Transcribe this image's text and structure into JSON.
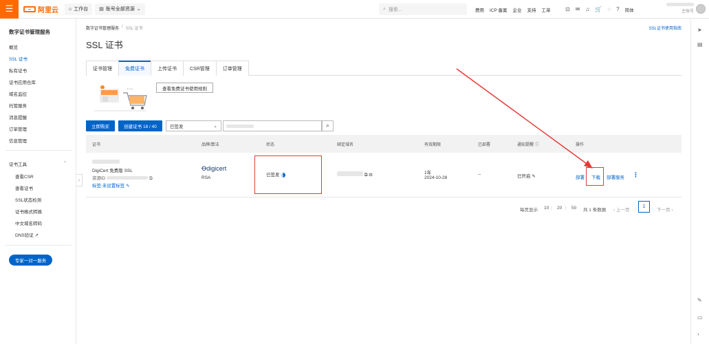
{
  "topbar": {
    "logo_text": "阿里云",
    "workbench": "工作台",
    "account_resources": "账号全部资源",
    "search_placeholder": "搜索...",
    "links": [
      "费用",
      "ICP 备案",
      "企业",
      "支持",
      "工单"
    ],
    "language": "简体",
    "account": "主账号"
  },
  "sidebar": {
    "title": "数字证书管理服务",
    "items": [
      "概览",
      "SSL 证书",
      "私有证书",
      "证书应用仓库",
      "域名监控",
      "托管服务",
      "消息提醒",
      "订单管理",
      "信息管理"
    ],
    "tools_title": "证书工具",
    "tools": [
      "查看CSR",
      "查看证书",
      "SSL状态检测",
      "证书格式转换",
      "中文域名转码",
      "DNS验证"
    ],
    "expert_button": "专家一对一服务"
  },
  "main": {
    "breadcrumb": [
      "数字证书管理服务",
      "/",
      "SSL 证书"
    ],
    "guide_link": "SSL证书使用指南",
    "title": "SSL 证书",
    "tabs": [
      "证书管理",
      "免费证书",
      "上传证书",
      "CSR管理",
      "订单管理"
    ],
    "rules_button": "查看免费证书使用规则",
    "buy_button": "立即购买",
    "create_button": "创建证书 18 / 40",
    "status_filter": "已签发",
    "table": {
      "headers": [
        "证书",
        "品牌/算法",
        "状态",
        "绑定域名",
        "有效期限",
        "已部署",
        "通知提醒",
        "操作"
      ],
      "row": {
        "cert_type": "DigiCert 免费版 SSL",
        "resource_id_label": "资源ID",
        "tag_label": "标签:未设置标签",
        "brand": "digicert",
        "algorithm": "RSA",
        "status": "已签发",
        "validity_duration": "1年",
        "validity_date": "2024-10-28",
        "deployed": "--",
        "notify": "已开启",
        "actions": [
          "部署",
          "下载",
          "部署服务"
        ]
      }
    },
    "pagination": {
      "per_page_label": "每页显示",
      "sizes": [
        "10",
        "20",
        "50"
      ],
      "total": "共 1 条数据",
      "prev": "上一页",
      "current": "1",
      "next": "下一页"
    }
  },
  "colors": {
    "brand_orange": "#ff6a00",
    "primary_blue": "#0064c8",
    "annotation_red": "#e53935"
  }
}
